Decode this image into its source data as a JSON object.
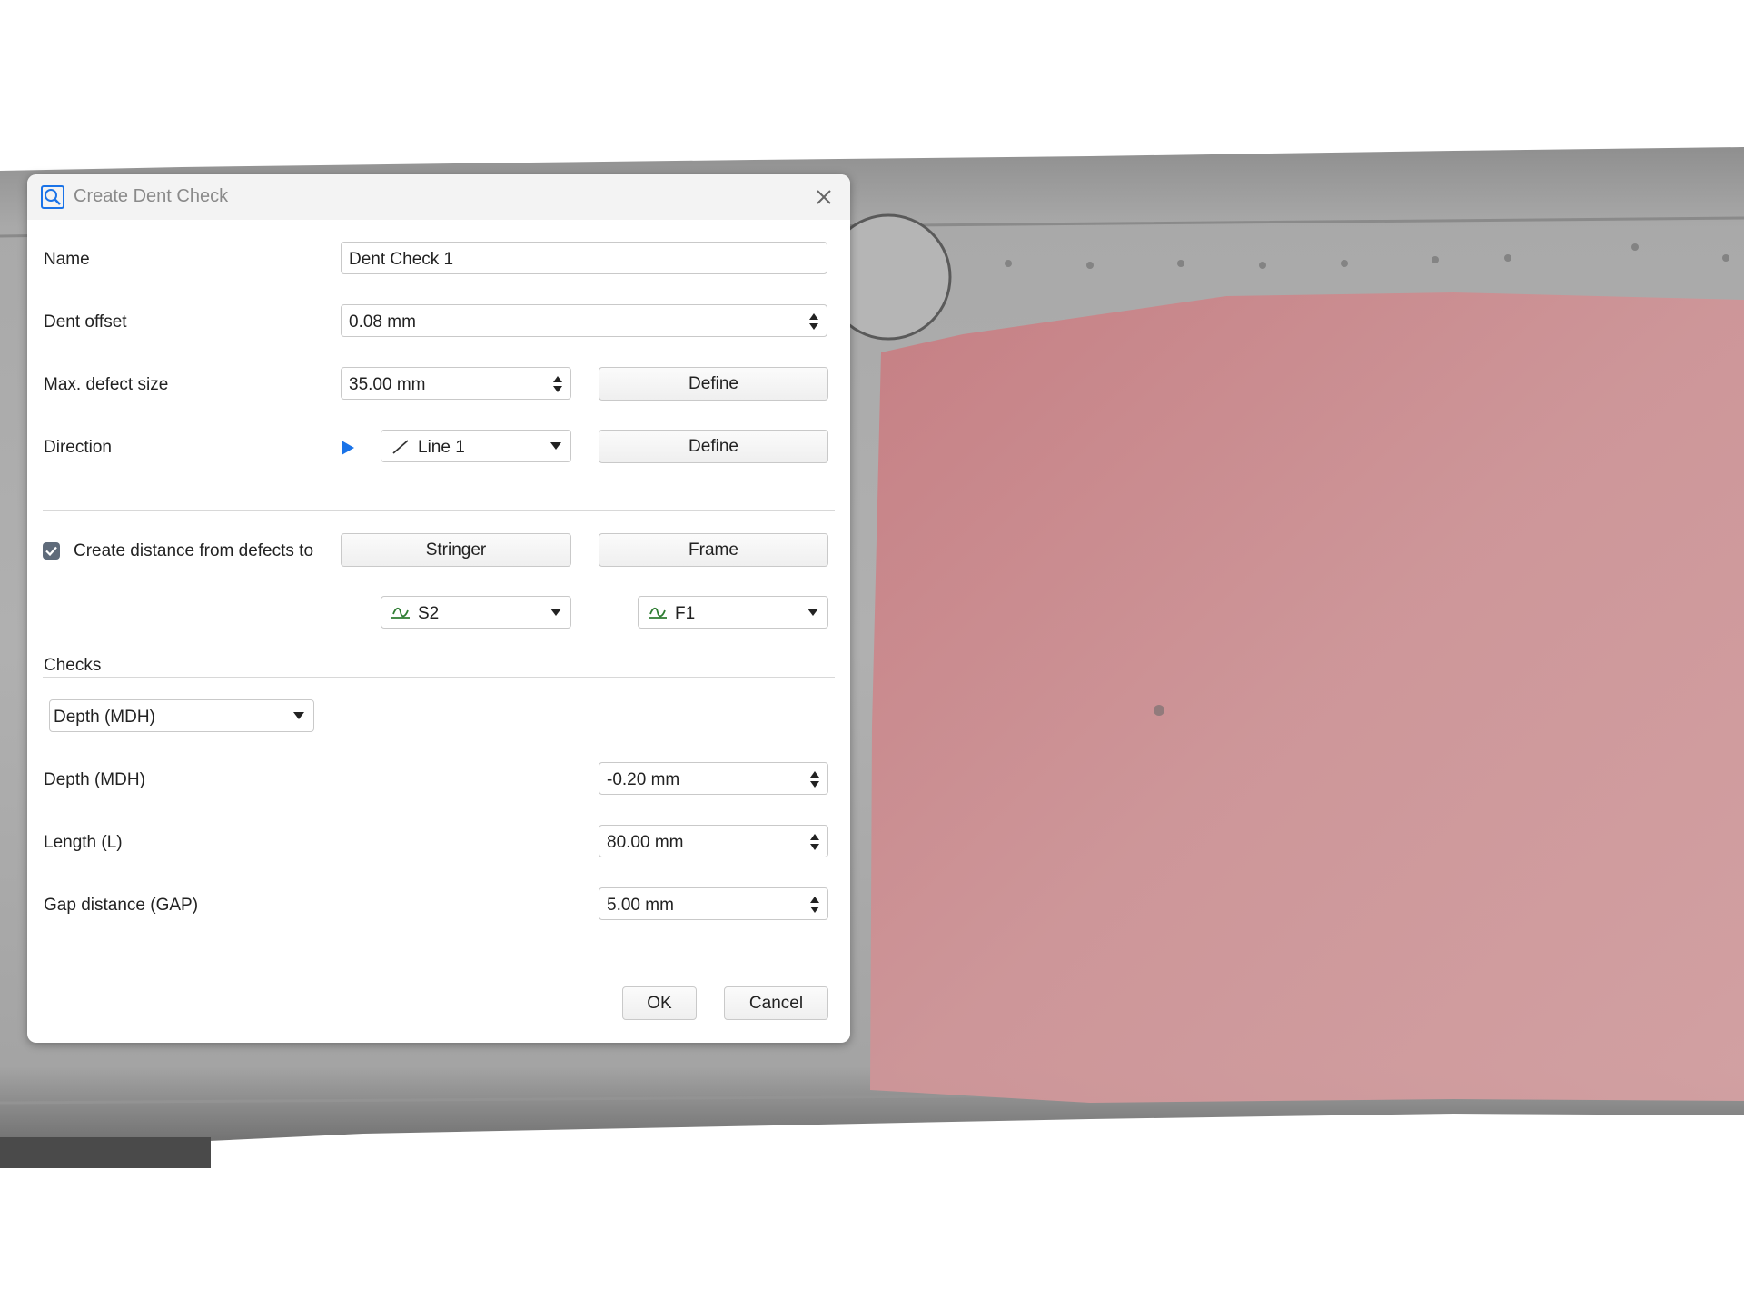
{
  "dialog": {
    "title": "Create Dent Check",
    "close_label": "×"
  },
  "form": {
    "name_label": "Name",
    "name_value": "Dent Check 1",
    "dent_offset_label": "Dent offset",
    "dent_offset_value": "0.08 mm",
    "max_defect_label": "Max. defect size",
    "max_defect_value": "35.00 mm",
    "define_label": "Define",
    "direction_label": "Direction",
    "direction_value": "Line 1",
    "create_distance_label": "Create distance from defects to",
    "create_distance_checked": true,
    "stringer_label": "Stringer",
    "frame_label": "Frame",
    "stringer_value": "S2",
    "frame_value": "F1"
  },
  "checks": {
    "section_label": "Checks",
    "check_type_value": "Depth (MDH)",
    "depth_label": "Depth (MDH)",
    "depth_value": "-0.20 mm",
    "length_label": "Length (L)",
    "length_value": "80.00 mm",
    "gap_label": "Gap distance (GAP)",
    "gap_value": "5.00 mm"
  },
  "footer": {
    "ok_label": "OK",
    "cancel_label": "Cancel"
  },
  "colors": {
    "accent": "#1a73e8",
    "surface_gray": "#a6a6a6",
    "defect_highlight": "#cf8a8d",
    "curve_icon_green": "#2e7d32"
  }
}
